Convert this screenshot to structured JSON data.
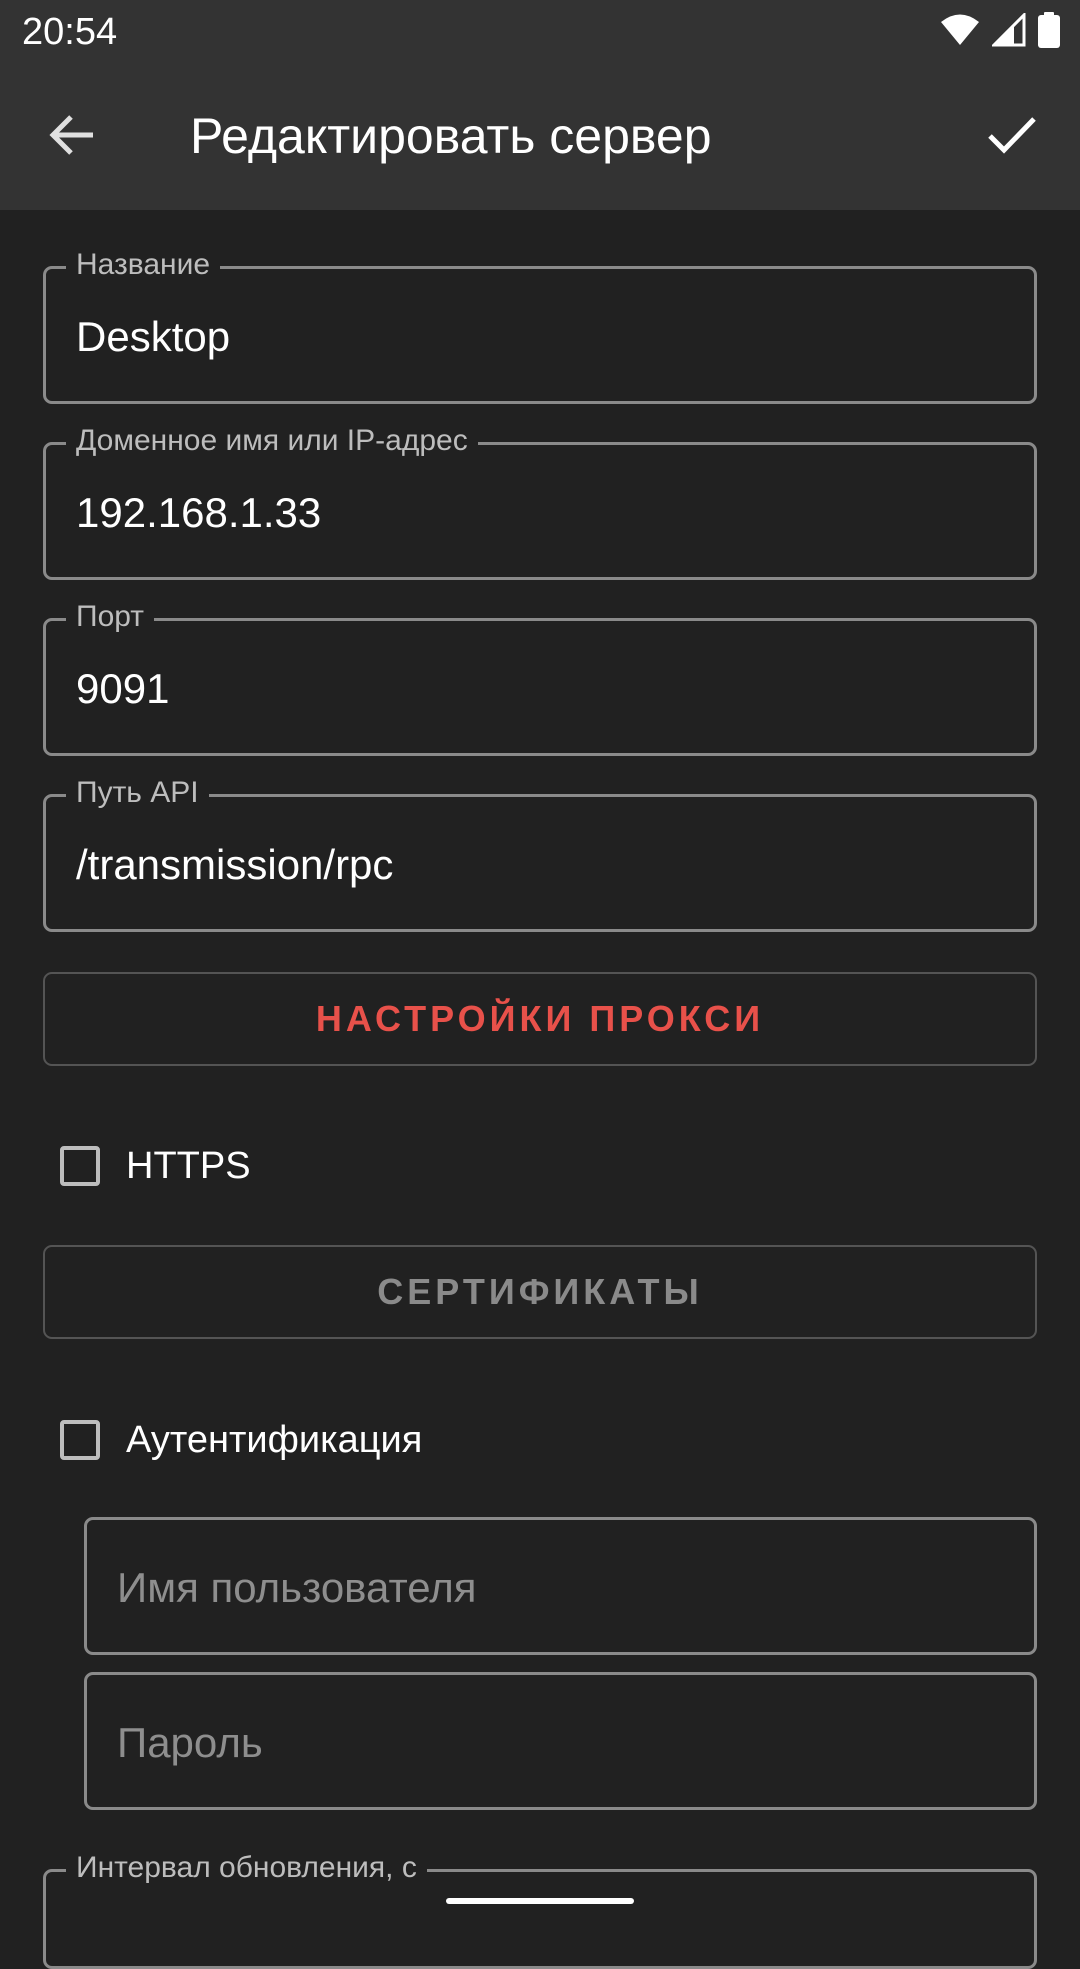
{
  "status": {
    "time": "20:54",
    "icons": [
      "wifi-icon",
      "cellular-signal-icon",
      "battery-icon"
    ]
  },
  "app_bar": {
    "title": "Редактировать сервер",
    "back_icon": "arrow-back-icon",
    "confirm_icon": "check-icon"
  },
  "fields": {
    "name": {
      "label": "Название",
      "value": "Desktop"
    },
    "host": {
      "label": "Доменное имя или IP-адрес",
      "value": "192.168.1.33"
    },
    "port": {
      "label": "Порт",
      "value": "9091"
    },
    "api_path": {
      "label": "Путь API",
      "value": "/transmission/rpc"
    },
    "username": {
      "placeholder": "Имя пользователя"
    },
    "password": {
      "placeholder": "Пароль"
    },
    "update_interval": {
      "label": "Интервал обновления, с"
    }
  },
  "buttons": {
    "proxy_settings": "НАСТРОЙКИ ПРОКСИ",
    "certificates": "СЕРТИФИКАТЫ"
  },
  "checkboxes": {
    "https": {
      "label": "HTTPS",
      "checked": false
    },
    "authentication": {
      "label": "Аутентификация",
      "checked": false
    }
  },
  "colors": {
    "accent": "#e8514a",
    "disabled_text": "#8a8a8a",
    "background": "#212121",
    "app_bar": "#333333"
  }
}
